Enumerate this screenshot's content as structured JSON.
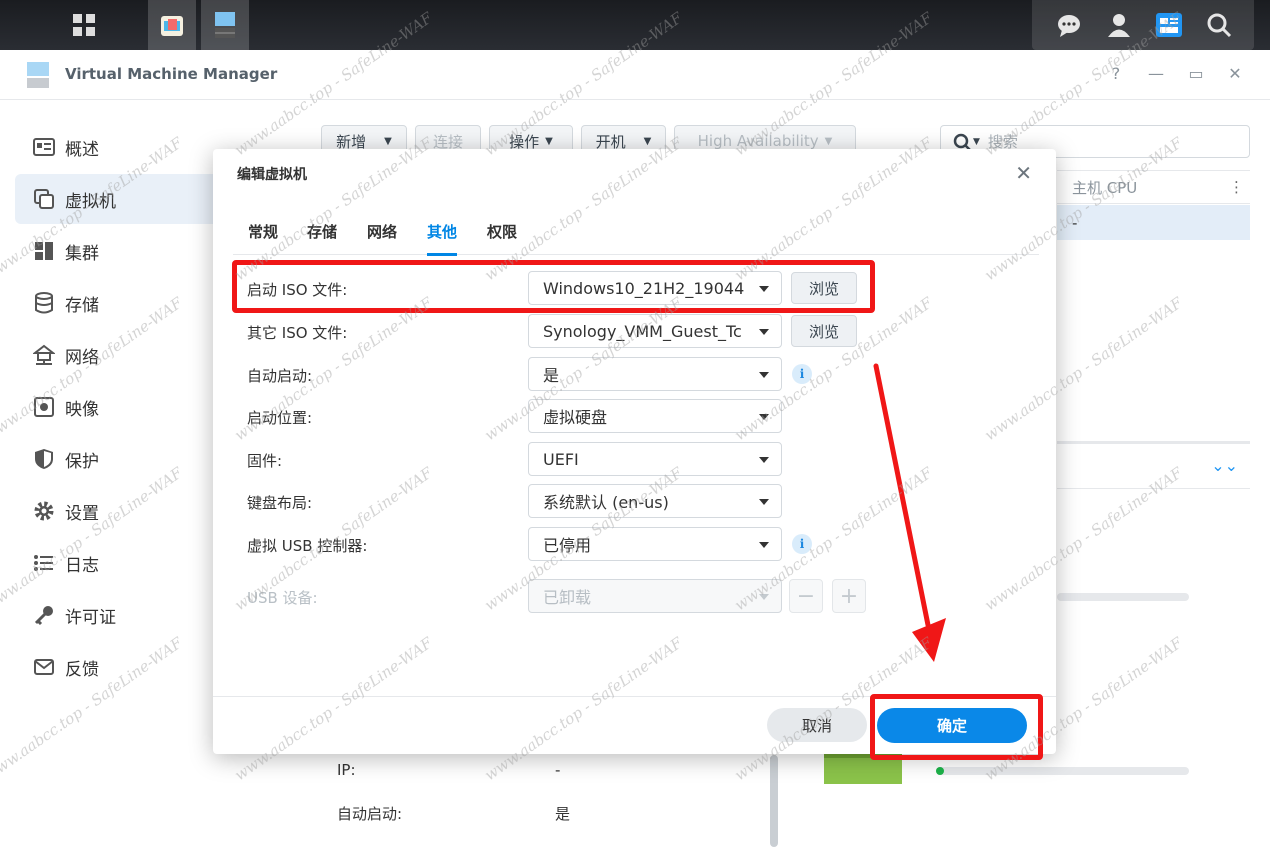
{
  "taskbar": {
    "apps": [
      {
        "icon": "grid-icon"
      },
      {
        "icon": "package-center-icon"
      },
      {
        "icon": "virtual-machine-icon"
      }
    ],
    "right_icons": [
      "chat-icon",
      "user-icon",
      "widgets-icon",
      "search-icon"
    ]
  },
  "window": {
    "title": "Virtual Machine Manager",
    "controls": {
      "help": "?",
      "minimize": "—",
      "maximize": "▭",
      "close": "✕"
    }
  },
  "sidebar": {
    "items": [
      {
        "label": "概述",
        "icon": "overview-icon"
      },
      {
        "label": "虚拟机",
        "icon": "vm-icon",
        "active": true
      },
      {
        "label": "集群",
        "icon": "cluster-icon"
      },
      {
        "label": "存储",
        "icon": "storage-icon"
      },
      {
        "label": "网络",
        "icon": "network-icon"
      },
      {
        "label": "映像",
        "icon": "image-icon"
      },
      {
        "label": "保护",
        "icon": "shield-icon"
      },
      {
        "label": "设置",
        "icon": "gear-icon"
      },
      {
        "label": "日志",
        "icon": "log-icon"
      },
      {
        "label": "许可证",
        "icon": "key-icon"
      },
      {
        "label": "反馈",
        "icon": "mail-icon"
      }
    ]
  },
  "toolbar": {
    "create": "新增",
    "connect": "连接",
    "action": "操作",
    "power_on": "开机",
    "ha": "High Availability",
    "search_placeholder": "搜索"
  },
  "grid": {
    "header_host_cpu": "主机 CPU",
    "row_host_cpu": "-"
  },
  "details": {
    "ip_label": "IP:",
    "ip_value": "-",
    "autostart_label": "自动启动:",
    "autostart_value": "是"
  },
  "modal": {
    "title": "编辑虚拟机",
    "close": "✕",
    "tabs": [
      {
        "label": "常规"
      },
      {
        "label": "存储"
      },
      {
        "label": "网络"
      },
      {
        "label": "其他",
        "active": true
      },
      {
        "label": "权限"
      }
    ],
    "rows": {
      "boot_iso": {
        "label": "启动 ISO 文件:",
        "value": "Windows10_21H2_19044",
        "browse": "浏览"
      },
      "other_iso": {
        "label": "其它 ISO 文件:",
        "value": "Synology_VMM_Guest_Tc",
        "browse": "浏览"
      },
      "autostart": {
        "label": "自动启动:",
        "value": "是"
      },
      "boot_from": {
        "label": "启动位置:",
        "value": "虚拟硬盘"
      },
      "firmware": {
        "label": "固件:",
        "value": "UEFI"
      },
      "keyboard": {
        "label": "键盘布局:",
        "value": "系统默认 (en-us)"
      },
      "usb_ctrl": {
        "label": "虚拟 USB 控制器:",
        "value": "已停用"
      },
      "usb_dev": {
        "label": "USB 设备:",
        "value": "已卸载",
        "minus": "−",
        "plus": "+"
      }
    },
    "info": "i",
    "cancel": "取消",
    "ok": "确定"
  },
  "watermark": "www.aabcc.top - SafeLine-WAF",
  "colors": {
    "accent": "#0086e5",
    "annotation": "#f01717"
  }
}
